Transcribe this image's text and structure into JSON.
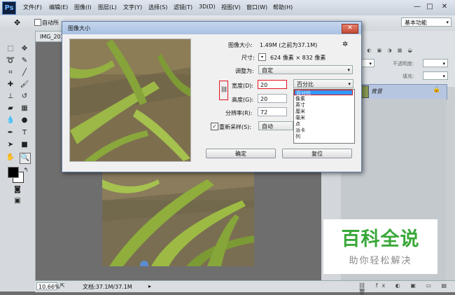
{
  "app": {
    "logo": "Ps"
  },
  "menu": [
    "文件(F)",
    "编辑(E)",
    "图像(I)",
    "图层(L)",
    "文字(Y)",
    "选择(S)",
    "滤镜(T)",
    "3D(D)",
    "视图(V)",
    "窗口(W)",
    "帮助(H)"
  ],
  "window_controls": {
    "minimize": "—",
    "restore": "□",
    "close": "✕"
  },
  "options_bar": {
    "auto_select": "自动所",
    "workspace": "基本功能"
  },
  "document": {
    "tab": "IMG_201",
    "zoom": "10.66%",
    "status": "文档:37.1M/37.1M"
  },
  "right_panel": {
    "opacity_label": "不透明度:",
    "fill_label": "填充:",
    "layer_name": "背景"
  },
  "dialog": {
    "title": "图像大小",
    "size_label": "图像大小:",
    "size_value": "1.49M (之前为37.1M)",
    "dim_label": "尺寸:",
    "dim_value": "624 像素 × 832 像素",
    "fit_label": "调整为:",
    "fit_value": "自定",
    "width_label": "宽度(D):",
    "width_value": "20",
    "height_label": "高度(G):",
    "height_value": "20",
    "resolution_label": "分辨率(R):",
    "resolution_value": "72",
    "resample_label": "重新采样(S):",
    "resample_value": "自动",
    "unit_selected": "百分比",
    "unit_options": [
      "百分比",
      "像素",
      "英寸",
      "厘米",
      "毫米",
      "点",
      "派卡",
      "列"
    ],
    "ok": "确定",
    "reset": "复位",
    "close": "✕"
  },
  "watermark": {
    "title": "百科全说",
    "subtitle": "助你轻松解决"
  },
  "colors": {
    "accent": "#3399ff",
    "highlight": "#e0141e",
    "watermark_green": "#39a839"
  }
}
